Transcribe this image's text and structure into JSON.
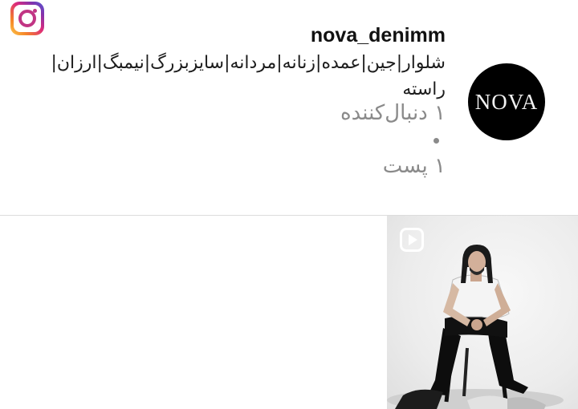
{
  "brand": {
    "logo_icon": "instagram-logo-icon",
    "gradient": [
      "#fdc94a",
      "#f58529",
      "#dd2a7b",
      "#8134af",
      "#515bd4"
    ]
  },
  "profile": {
    "username": "nova_denimm",
    "bio_line1": "شلوار|جین|عمده|زنانه|مردانه|سایزبزرگ|نیمبگ|ارزان|",
    "bio_line2": "راسته",
    "followers": "۱ دنبال‌کننده",
    "posts": "۱ پست",
    "avatar_text": "NOVA"
  },
  "grid": {
    "posts": [
      {
        "type": "reel",
        "icon": "reel-play-icon"
      }
    ]
  }
}
